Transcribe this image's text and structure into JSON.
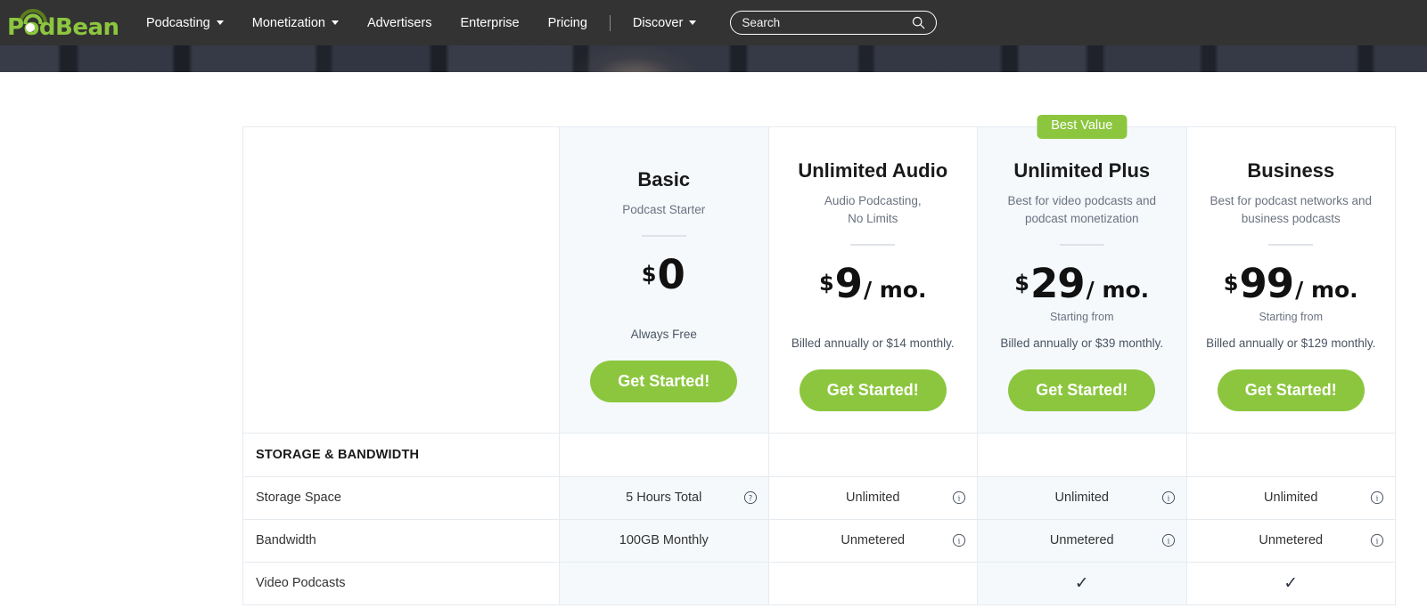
{
  "nav": {
    "logo_text": "PodBean",
    "logo_icon": "podbean-signal-arc-logo",
    "items": [
      {
        "label": "Podcasting",
        "has_caret": true,
        "name": "podcasting"
      },
      {
        "label": "Monetization",
        "has_caret": true,
        "name": "monetization"
      },
      {
        "label": "Advertisers",
        "has_caret": false,
        "name": "advertisers"
      },
      {
        "label": "Enterprise",
        "has_caret": false,
        "name": "enterprise"
      },
      {
        "label": "Pricing",
        "has_caret": false,
        "name": "pricing"
      }
    ],
    "divider": "|",
    "discover": {
      "label": "Discover",
      "has_caret": true
    },
    "search": {
      "placeholder": "Search",
      "value": "",
      "icon": "search-icon"
    }
  },
  "colors": {
    "brand_green": "#8cc63f",
    "nav_background": "#333333",
    "hero_background": "#2e323e",
    "column_tint": "#f5f9fc",
    "border": "#e6ebf0"
  },
  "pricing": {
    "badge": {
      "label": "Best Value",
      "on_plan": "Unlimited Plus"
    },
    "cta_label": "Get Started!",
    "plans": [
      {
        "name": "Basic",
        "tagline": "Podcast Starter",
        "currency": "$",
        "amount": "0",
        "per": "",
        "starting_from": "",
        "billing": "Always Free",
        "cta": "Get Started!",
        "tinted": true,
        "badge": false
      },
      {
        "name": "Unlimited Audio",
        "tagline": "Audio Podcasting,\nNo Limits",
        "currency": "$",
        "amount": "9",
        "per": "/ mo.",
        "starting_from": "",
        "billing": "Billed annually or $14 monthly.",
        "cta": "Get Started!",
        "tinted": false,
        "badge": false
      },
      {
        "name": "Unlimited Plus",
        "tagline": "Best for video podcasts and podcast monetization",
        "currency": "$",
        "amount": "29",
        "per": "/ mo.",
        "starting_from": "Starting from",
        "billing": "Billed annually or $39 monthly.",
        "cta": "Get Started!",
        "tinted": true,
        "badge": true
      },
      {
        "name": "Business",
        "tagline": "Best for podcast networks and business podcasts",
        "currency": "$",
        "amount": "99",
        "per": "/ mo.",
        "starting_from": "Starting from",
        "billing": "Billed annually or $129 monthly.",
        "cta": "Get Started!",
        "tinted": false,
        "badge": false
      }
    ],
    "sections": [
      {
        "title": "STORAGE & BANDWIDTH",
        "rows": [
          {
            "feature": "Storage Space",
            "values": [
              {
                "text": "5 Hours Total",
                "icon": "help-circle-icon"
              },
              {
                "text": "Unlimited",
                "icon": "info-circle-icon"
              },
              {
                "text": "Unlimited",
                "icon": "info-circle-icon"
              },
              {
                "text": "Unlimited",
                "icon": "info-circle-icon"
              }
            ]
          },
          {
            "feature": "Bandwidth",
            "values": [
              {
                "text": "100GB Monthly",
                "icon": ""
              },
              {
                "text": "Unmetered",
                "icon": "info-circle-icon"
              },
              {
                "text": "Unmetered",
                "icon": "info-circle-icon"
              },
              {
                "text": "Unmetered",
                "icon": "info-circle-icon"
              }
            ]
          },
          {
            "feature": "Video Podcasts",
            "values": [
              {
                "text": "",
                "icon": ""
              },
              {
                "text": "",
                "icon": ""
              },
              {
                "text": "✓",
                "icon": ""
              },
              {
                "text": "✓",
                "icon": ""
              }
            ]
          }
        ]
      }
    ]
  }
}
